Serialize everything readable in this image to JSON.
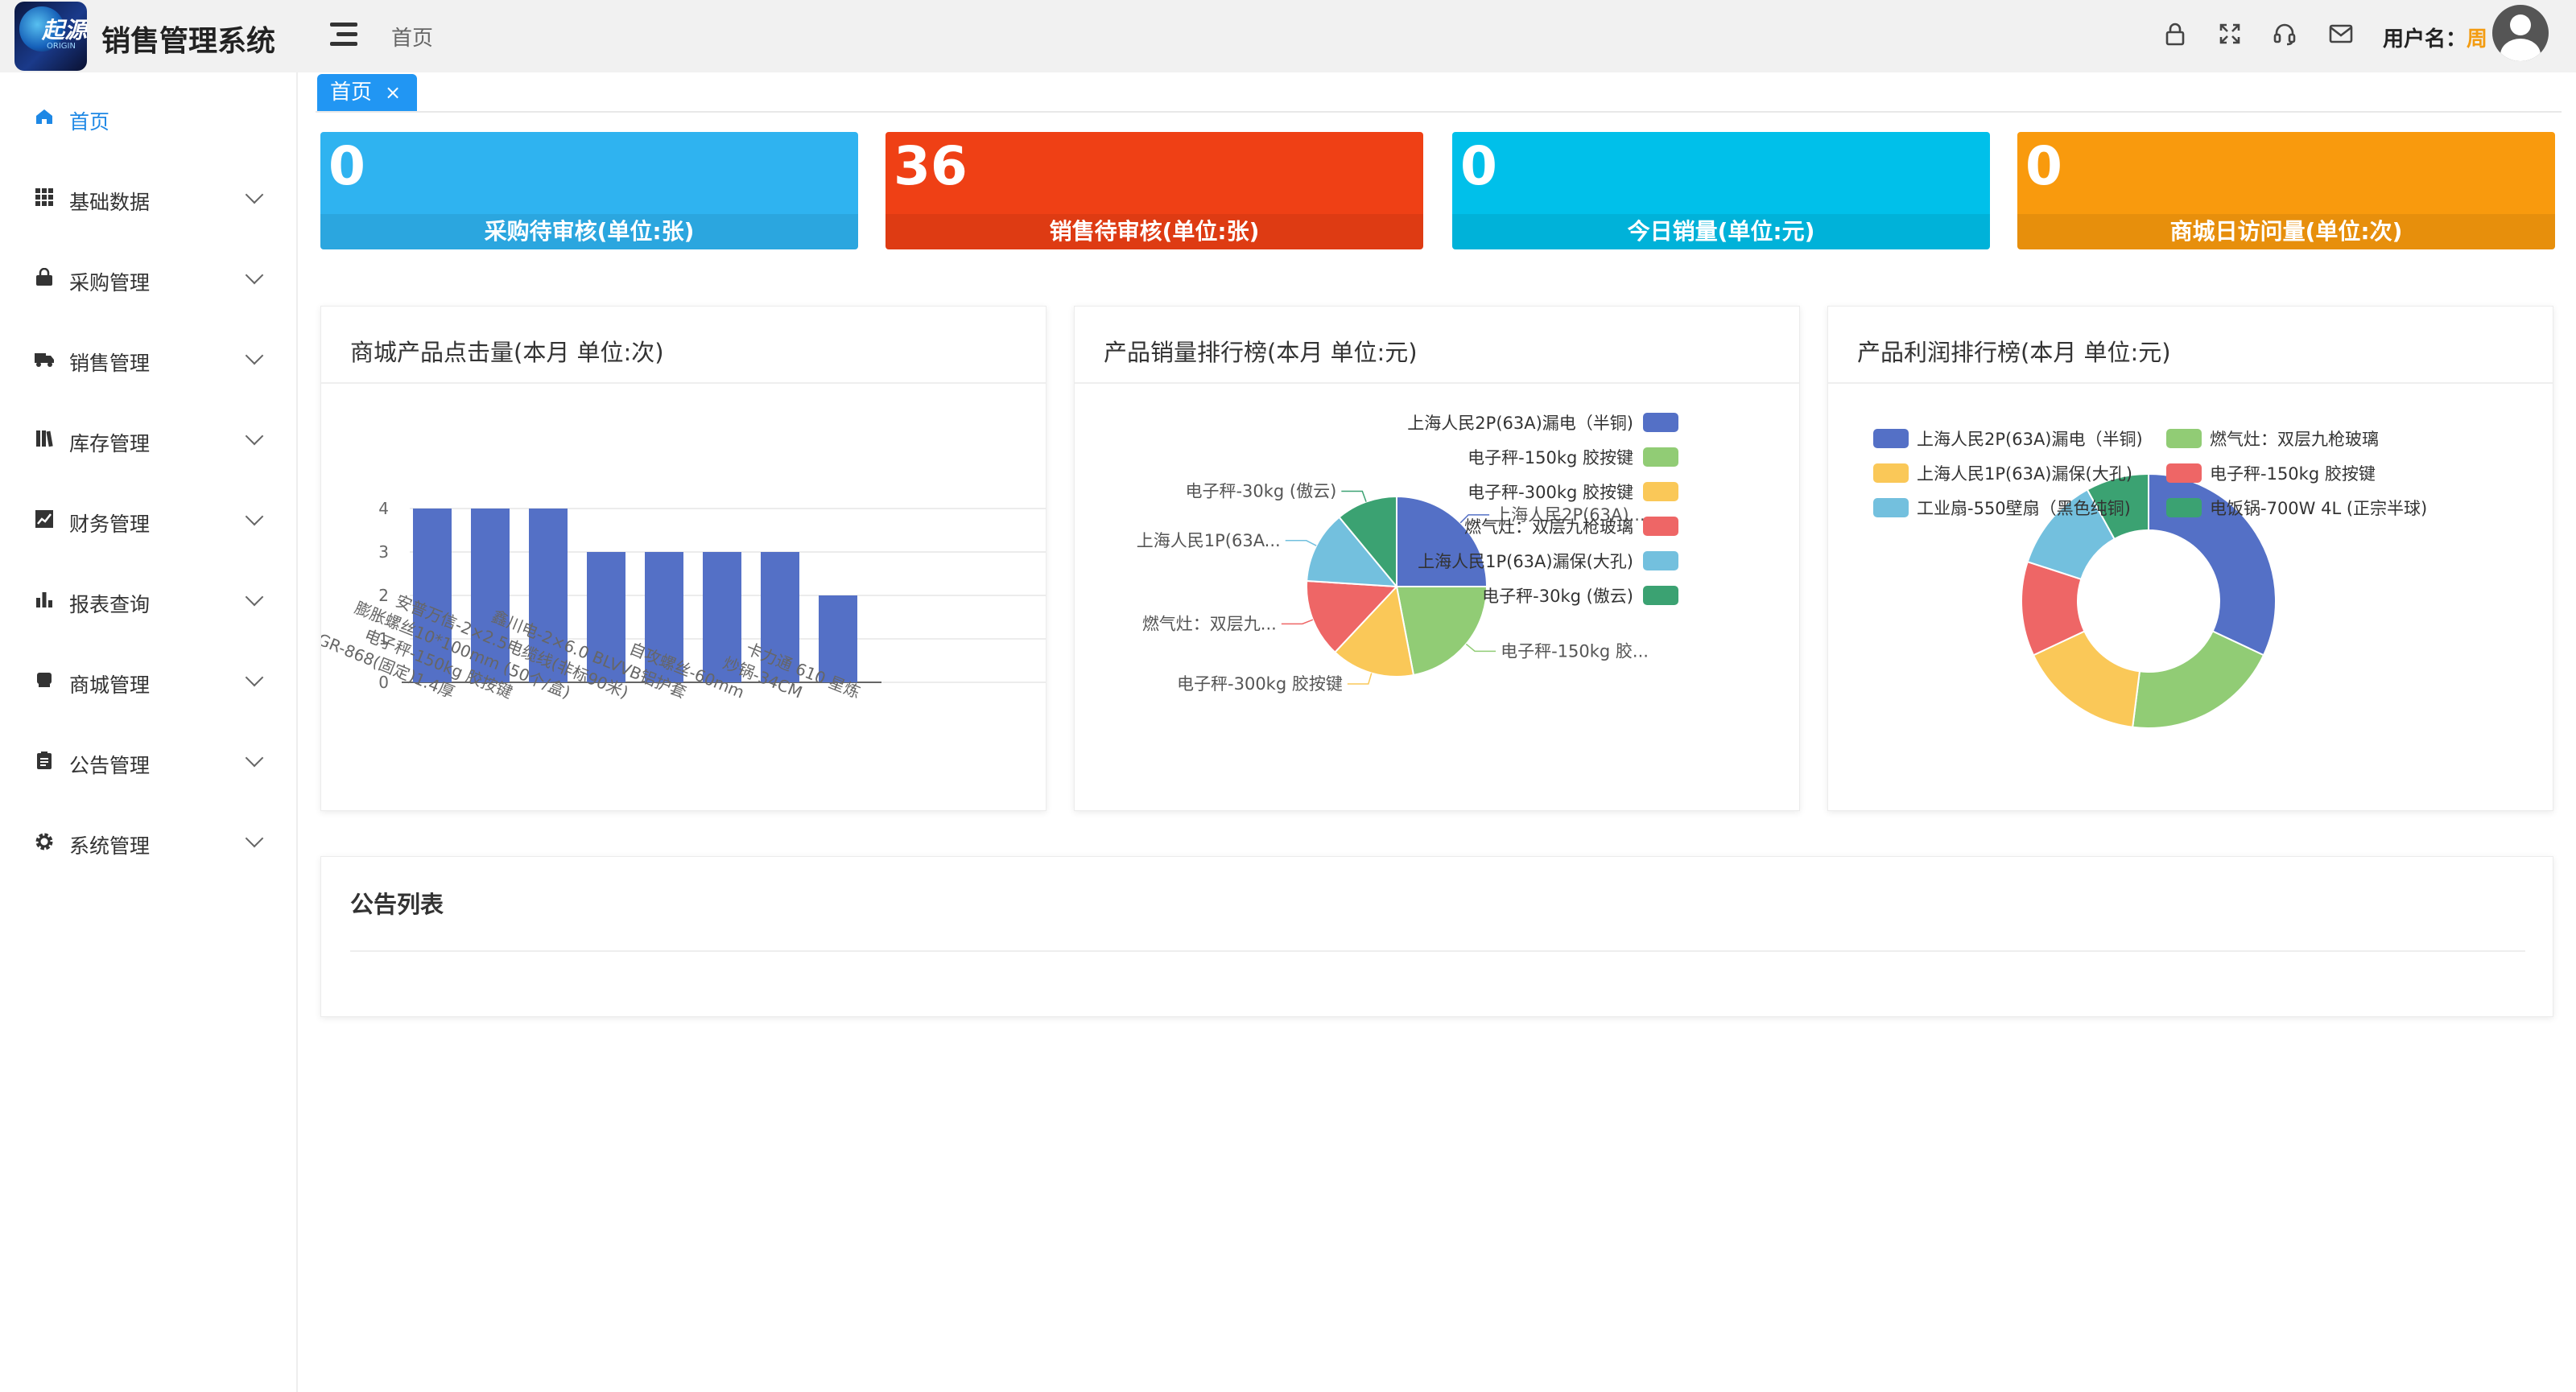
{
  "header": {
    "logo_text": "起源",
    "logo_sub": "ORIGIN",
    "app_title": "销售管理系统",
    "breadcrumb": "首页",
    "user_label": "用户名：",
    "user_name": "周",
    "icons": [
      "lock-icon",
      "fullscreen-icon",
      "headset-icon",
      "mail-icon"
    ]
  },
  "sidebar": {
    "items": [
      {
        "label": "首页",
        "icon": "home-icon",
        "active": true
      },
      {
        "label": "基础数据",
        "icon": "grid-icon"
      },
      {
        "label": "采购管理",
        "icon": "bag-icon"
      },
      {
        "label": "销售管理",
        "icon": "truck-icon"
      },
      {
        "label": "库存管理",
        "icon": "books-icon"
      },
      {
        "label": "财务管理",
        "icon": "trend-icon"
      },
      {
        "label": "报表查询",
        "icon": "bar-chart-icon"
      },
      {
        "label": "商城管理",
        "icon": "shop-icon"
      },
      {
        "label": "公告管理",
        "icon": "clipboard-icon"
      },
      {
        "label": "系统管理",
        "icon": "gear-icon"
      }
    ]
  },
  "tabs": [
    {
      "label": "首页",
      "close": "×"
    }
  ],
  "stats": [
    {
      "value": "0",
      "caption": "采购待审核(单位:张)",
      "color": "#2fb3f0"
    },
    {
      "value": "36",
      "caption": "销售待审核(单位:张)",
      "color": "#ef4015"
    },
    {
      "value": "0",
      "caption": "今日销量(单位:元)",
      "color": "#00c0ea"
    },
    {
      "value": "0",
      "caption": "商城日访问量(单位:次)",
      "color": "#f99a0d"
    }
  ],
  "panels": {
    "clicks_title": "商城产品点击量(本月 单位:次)",
    "sales_title": "产品销量排行榜(本月 单位:元)",
    "profit_title": "产品利润排行榜(本月 单位:元)",
    "notice_title": "公告列表"
  },
  "chart_data": [
    {
      "type": "bar",
      "title": "商城产品点击量(本月 单位:次)",
      "categories": [
        "二级插头:GR-868(固定)1.4厚",
        "电子秤-150kg 胶按键",
        "膨胀螺丝10*100mm (50个/盒)",
        "安普万信-2×2.5电缆线(非标90米)",
        "鑫川电-2×6.0 BLVVB铝护套",
        "自攻螺丝-60mm",
        "炒锅-34CM",
        "卡力通 610 星炼"
      ],
      "values": [
        4,
        4,
        4,
        3,
        3,
        3,
        3,
        2
      ],
      "ylim": [
        0,
        4
      ],
      "color": "#5470c6"
    },
    {
      "type": "pie",
      "title": "产品销量排行榜(本月 单位:元)",
      "legend": [
        "上海人民2P(63A)漏电（半铜)",
        "电子秤-150kg 胶按键",
        "电子秤-300kg 胶按键",
        "燃气灶：双层九枪玻璃",
        "上海人民1P(63A)漏保(大孔)",
        "电子秤-30kg (傲云)"
      ],
      "labels": [
        "上海人民2P(63A)...",
        "电子秤-150kg 胶...",
        "电子秤-300kg 胶按键",
        "燃气灶：双层九...",
        "上海人民1P(63A...",
        "电子秤-30kg (傲云)"
      ],
      "values": [
        25,
        22,
        15,
        14,
        13,
        11
      ],
      "colors": [
        "#5470c6",
        "#91cc75",
        "#fac858",
        "#ee6666",
        "#73c0de",
        "#3ba272"
      ]
    },
    {
      "type": "pie",
      "title": "产品利润排行榜(本月 单位:元)",
      "legend": [
        "上海人民2P(63A)漏电（半铜)",
        "燃气灶：双层九枪玻璃",
        "上海人民1P(63A)漏保(大孔)",
        "电子秤-150kg 胶按键",
        "工业扇-550壁扇（黑色纯铜)",
        "电饭锅-700W 4L (正宗半球)"
      ],
      "values": [
        32,
        20,
        16,
        12,
        12,
        8
      ],
      "order_colors": [
        "#5470c6",
        "#91cc75",
        "#fac858",
        "#ee6666",
        "#73c0de",
        "#3ba272"
      ]
    }
  ]
}
